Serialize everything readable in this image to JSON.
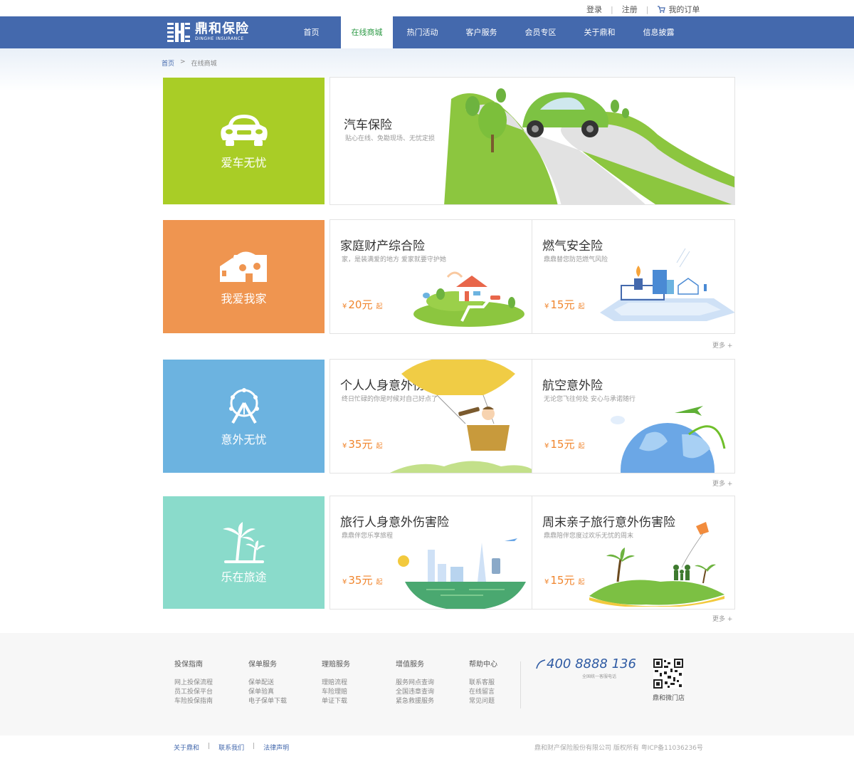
{
  "top_links": {
    "login": "登录",
    "register": "注册",
    "my_orders": "我的订单"
  },
  "logo": {
    "cn": "鼎和保险",
    "en": "DINGHE INSURANCE"
  },
  "nav": [
    {
      "label": "首页"
    },
    {
      "label": "在线商城",
      "active": true
    },
    {
      "label": "热门活动"
    },
    {
      "label": "客户服务"
    },
    {
      "label": "会员专区"
    },
    {
      "label": "关于鼎和"
    },
    {
      "label": "信息披露"
    }
  ],
  "breadcrumb": {
    "home": "首页",
    "current": "在线商城"
  },
  "colors": {
    "header": "#4469ad",
    "tile_car": "#a9cd26",
    "tile_home": "#ef9550",
    "tile_accident": "#6cb3e0",
    "tile_travel": "#8adbcb",
    "price": "#f0852d",
    "active_nav_text": "#2d9a45"
  },
  "sections": {
    "car": {
      "tile_label": "爱车无忧",
      "tile_icon": "car-icon",
      "card": {
        "title": "汽车保险",
        "subtitle": "贴心在线、免勘现场、无忧定损"
      }
    },
    "home": {
      "tile_label": "我爱我家",
      "tile_icon": "house-icon",
      "cards": [
        {
          "title": "家庭财产综合险",
          "subtitle": "家，是装满爱的地方  爱家就要守护她",
          "currency": "¥",
          "price": "20元",
          "suffix": "起"
        },
        {
          "title": "燃气安全险",
          "subtitle": "鼎鼎替您防范燃气风险",
          "currency": "¥",
          "price": "15元",
          "suffix": "起"
        }
      ],
      "more": "更多 +"
    },
    "accident": {
      "tile_label": "意外无忧",
      "tile_icon": "ferris-wheel-icon",
      "cards": [
        {
          "title": "个人人身意外伤害险",
          "subtitle": "终日忙碌的你是时候对自己好点了",
          "currency": "¥",
          "price": "35元",
          "suffix": "起"
        },
        {
          "title": "航空意外险",
          "subtitle": "无论您飞往何处  安心与承诺随行",
          "currency": "¥",
          "price": "15元",
          "suffix": "起"
        }
      ],
      "more": "更多 +"
    },
    "travel": {
      "tile_label": "乐在旅途",
      "tile_icon": "palm-tree-icon",
      "cards": [
        {
          "title": "旅行人身意外伤害险",
          "subtitle": "鼎鼎伴您乐享旅程",
          "currency": "¥",
          "price": "35元",
          "suffix": "起"
        },
        {
          "title": "周末亲子旅行意外伤害险",
          "subtitle": "鼎鼎陪伴您度过欢乐无忧的周末",
          "currency": "¥",
          "price": "15元",
          "suffix": "起"
        }
      ],
      "more": "更多 +"
    }
  },
  "footer": {
    "columns": [
      {
        "title": "投保指南",
        "links": [
          "网上投保流程",
          "员工投保平台",
          "车险投保指南"
        ]
      },
      {
        "title": "保单服务",
        "links": [
          "保单配送",
          "保单验真",
          "电子保单下载"
        ]
      },
      {
        "title": "理赔服务",
        "links": [
          "理赔流程",
          "车险理赔",
          "单证下载"
        ]
      },
      {
        "title": "增值服务",
        "links": [
          "服务网点查询",
          "全国违章查询",
          "紧急救援服务"
        ]
      },
      {
        "title": "帮助中心",
        "links": [
          "联系客服",
          "在线留言",
          "常见问题"
        ]
      }
    ],
    "hotline": "400 8888 136",
    "hotline_sub": "全国统一客服电话",
    "qr_label": "鼎和微门店"
  },
  "bottom": {
    "links": [
      "关于鼎和",
      "联系我们",
      "法律声明"
    ],
    "separator": "|",
    "copyright": "鼎和财产保险股份有限公司 版权所有 粤ICP备11036236号"
  }
}
